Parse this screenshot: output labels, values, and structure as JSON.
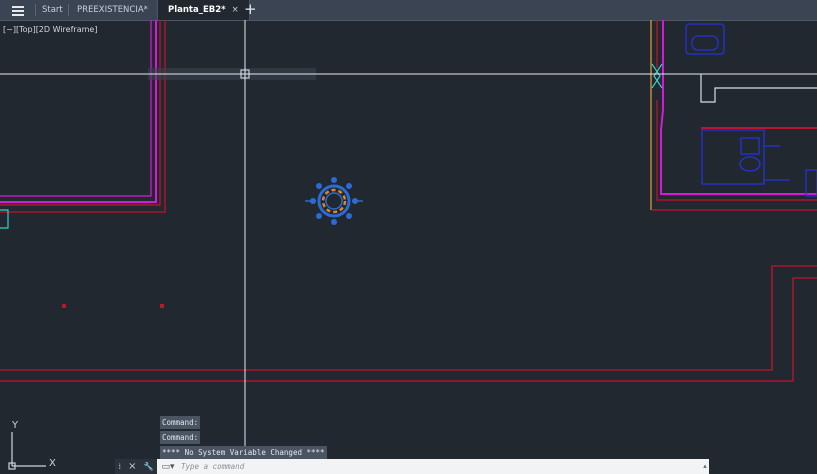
{
  "tabs": [
    {
      "label": "Start"
    },
    {
      "label": "PREEXISTENCIA*"
    },
    {
      "label": "Planta_EB2*"
    }
  ],
  "tab_close_glyph": "×",
  "new_tab_glyph": "+",
  "viewport_controls": "[−][Top][2D Wireframe]",
  "command_history": [
    "Command:",
    "Command:",
    "**** No System Variable Changed ****"
  ],
  "command_input": {
    "placeholder": "Type a command",
    "value": ""
  },
  "command_tools": {
    "close": "×",
    "customize": "🔧"
  },
  "ucs": {
    "x_label": "X",
    "y_label": "Y"
  },
  "colors": {
    "background": "#212830",
    "wall_magenta": "#d21bd6",
    "wall_red": "#c2132e",
    "blue": "#2433d8",
    "cyan": "#33d1c5",
    "crosshair": "#e7eaee",
    "orange": "#e0862a",
    "white_lines": "#d9dde2"
  },
  "icons": [
    "menu-icon",
    "ucs-icon",
    "close-icon",
    "wrench-icon",
    "command-prompt-icon"
  ]
}
